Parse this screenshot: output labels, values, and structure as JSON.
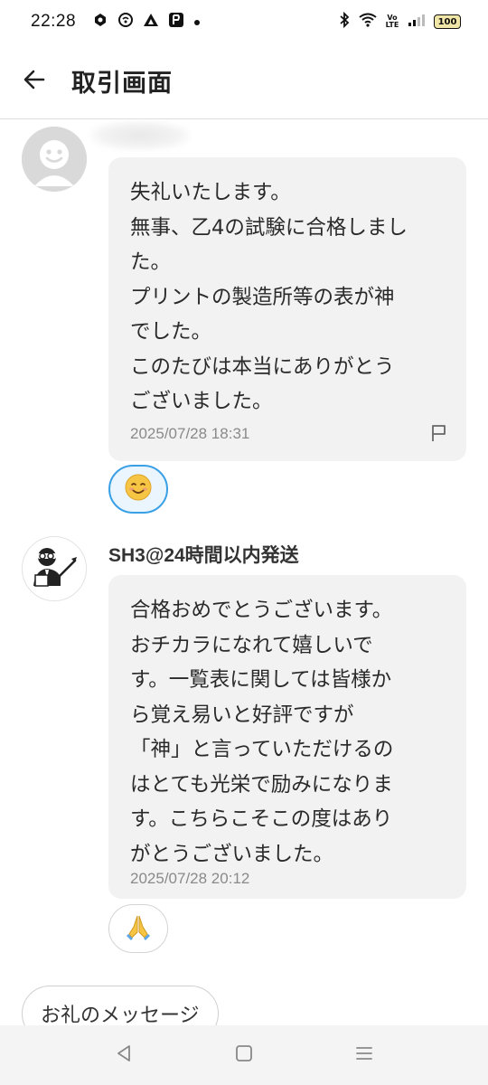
{
  "status": {
    "time": "22:28",
    "left_icons": [
      "stack-icon",
      "chat-icon",
      "triangle-icon",
      "app-icon",
      "dot-icon"
    ],
    "right_icons": [
      "bluetooth-icon",
      "wifi-icon",
      "volte-icon",
      "signal-icon"
    ],
    "volte": "Vo LTE",
    "battery": "100"
  },
  "header": {
    "title": "取引画面",
    "back_icon": "arrow-left-icon"
  },
  "messages": [
    {
      "sender": "",
      "avatar": "smiley-avatar",
      "lines": [
        "失礼いたします。",
        "無事、乙4の試験に合格しまし",
        "た。",
        "プリントの製造所等の表が神",
        "でした。",
        "このたびは本当にありがとう",
        "ございました。"
      ],
      "time": "2025/07/28 18:31",
      "reaction": "😊"
    },
    {
      "sender": "SH3@24時間以内発送",
      "avatar": "teacher-avatar",
      "lines": [
        "合格おめでとうございます。",
        "おチカラになれて嬉しいで",
        "す。一覧表に関しては皆様か",
        "ら覚え易いと好評ですが",
        "「神」と言っていただけるの",
        "はとても光栄で励みになりま",
        "す。こちらこそこの度はあり",
        "がとうございました。"
      ],
      "time": "2025/07/28 20:12",
      "reaction": "🙏"
    }
  ],
  "actions": {
    "thanks_label": "お礼のメッセージ"
  },
  "nav": [
    "back-triangle-icon",
    "home-square-icon",
    "recents-menu-icon"
  ],
  "colors": {
    "bubble_bg": "#f2f2f2",
    "reaction_selected_border": "#3aa0e6",
    "timestamp": "#8a8a8a"
  }
}
